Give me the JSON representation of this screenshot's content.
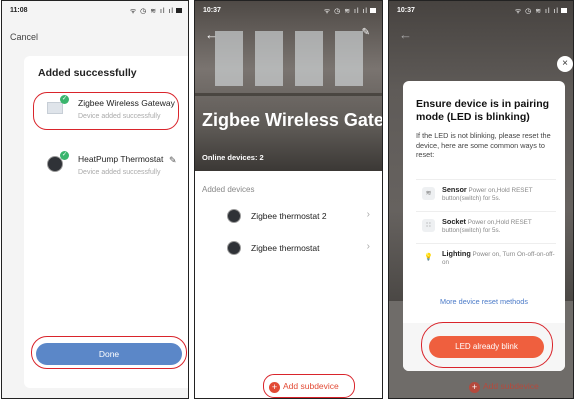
{
  "screen1": {
    "time": "11:08",
    "status_icons": "ᯤ ◷ ≋ ıl ıl",
    "cancel": "Cancel",
    "title": "Added successfully",
    "devices": [
      {
        "name": "Zigbee Wireless Gateway",
        "status": "Device added successfully",
        "icon": "gateway-icon"
      },
      {
        "name": "HeatPump Thermostat",
        "status": "Device added successfully",
        "icon": "thermostat-icon"
      }
    ],
    "done": "Done"
  },
  "screen2": {
    "time": "10:37",
    "status_icons": "ᯤ ◷ ≋ ıl ıl",
    "title": "Zigbee Wireless Gatew..",
    "online": "Online devices: 2",
    "added_devices": "Added devices",
    "devices": [
      {
        "name": "Zigbee thermostat 2"
      },
      {
        "name": "Zigbee thermostat"
      }
    ],
    "add_subdevice": "Add subdevice"
  },
  "screen3": {
    "time": "10:37",
    "status_icons": "ᯤ ◷ ≋ ıl ıl",
    "title": "Ensure device is in pairing mode (LED is blinking)",
    "description": "If the LED is not blinking, please reset the device, here are some common ways to reset:",
    "options": [
      {
        "name": "Sensor",
        "text": "Power on,Hold RESET button(switch) for 5s.",
        "icon": "sensor-icon"
      },
      {
        "name": "Socket",
        "text": "Power on,Hold RESET button(switch) for 5s.",
        "icon": "socket-icon"
      },
      {
        "name": "Lighting",
        "text": "Power on, Turn On-off-on-off-on",
        "icon": "bulb-icon"
      }
    ],
    "more": "More device reset methods",
    "led_button": "LED already blink",
    "add_subdevice": "Add subdevice"
  },
  "colors": {
    "accent_red": "#d9242b",
    "done_blue": "#5b87c8",
    "orange": "#ef5f3e",
    "success": "#3ab56d"
  }
}
